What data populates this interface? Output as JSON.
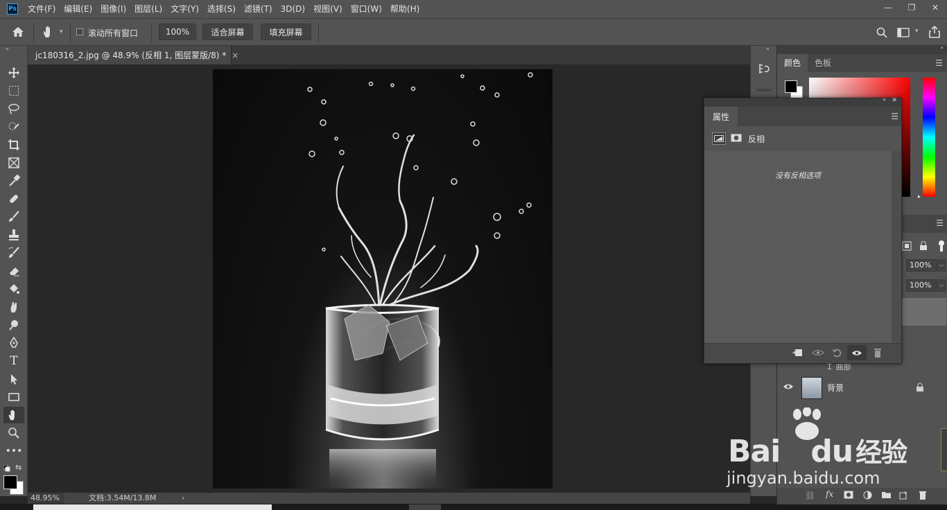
{
  "app": {
    "logo": "Ps"
  },
  "menu": [
    "文件(F)",
    "编辑(E)",
    "图像(I)",
    "图层(L)",
    "文字(Y)",
    "选择(S)",
    "滤镜(T)",
    "3D(D)",
    "视图(V)",
    "窗口(W)",
    "帮助(H)"
  ],
  "window_controls": {
    "minimize": "—",
    "restore": "❐",
    "close": "✕"
  },
  "options": {
    "scroll_all": "滚动所有窗口",
    "zoom": "100%",
    "fit_screen": "适合屏幕",
    "fill_screen": "填充屏幕"
  },
  "document": {
    "tab_title": "jc180316_2.jpg @ 48.9% (反相 1, 图层蒙版/8) *",
    "close": "×"
  },
  "status": {
    "zoom": "48.95%",
    "doc_info": "文档:3.54M/13.8M",
    "arrow": "›"
  },
  "color_panel": {
    "tab_color": "颜色",
    "tab_swatches": "色板",
    "foreground": "#000000",
    "background": "#ffffff"
  },
  "layers": {
    "opacity": "100%",
    "fill": "100%",
    "partial_label": "Ｉ 曲部",
    "background_layer": "背景"
  },
  "properties": {
    "tab": "属性",
    "adjustment_name": "反相",
    "no_options": "没有反相选项"
  },
  "watermark": {
    "brand_latin": "Bai",
    "brand_latin_end": "du",
    "brand_cn": "经验",
    "url": "jingyan.baidu.com"
  },
  "colors": {
    "ui_panel": "#535353",
    "ui_dark": "#282828",
    "accent": "#31a8ff"
  }
}
